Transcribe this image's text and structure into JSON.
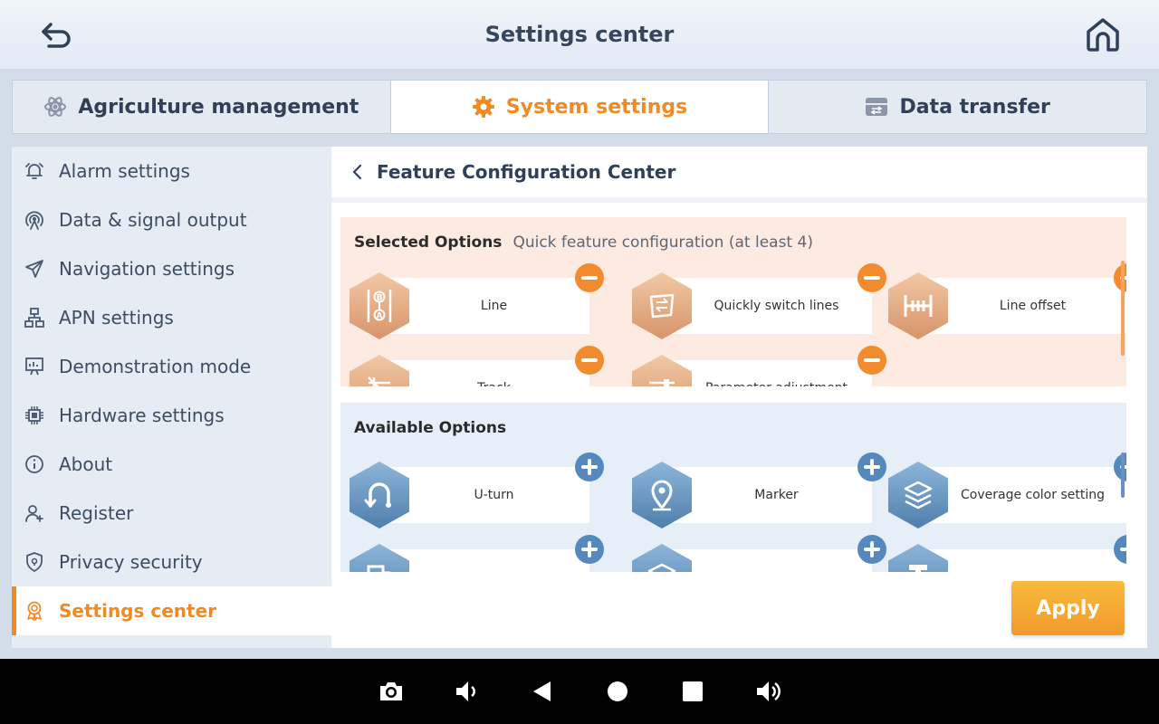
{
  "header": {
    "title": "Settings center"
  },
  "tabs": [
    {
      "label": "Agriculture management",
      "icon": "atom-icon"
    },
    {
      "label": "System settings",
      "icon": "gear-icon",
      "active": true
    },
    {
      "label": "Data transfer",
      "icon": "database-icon"
    }
  ],
  "sidebar": {
    "items": [
      {
        "label": "Alarm settings",
        "icon": "bell-icon"
      },
      {
        "label": "Data & signal output",
        "icon": "signal-icon"
      },
      {
        "label": "Navigation settings",
        "icon": "send-icon"
      },
      {
        "label": "APN settings",
        "icon": "network-icon"
      },
      {
        "label": "Demonstration mode",
        "icon": "presentation-icon"
      },
      {
        "label": "Hardware settings",
        "icon": "chip-icon"
      },
      {
        "label": "About",
        "icon": "info-icon"
      },
      {
        "label": "Register",
        "icon": "user-add-icon"
      },
      {
        "label": "Privacy security",
        "icon": "shield-icon"
      },
      {
        "label": "Settings center",
        "icon": "award-icon",
        "active": true
      }
    ]
  },
  "content": {
    "title": "Feature Configuration Center",
    "selected": {
      "heading": "Selected Options",
      "subheading": "Quick feature configuration (at least 4)",
      "items": [
        {
          "label": "Line",
          "icon": "ab-line-icon"
        },
        {
          "label": "Quickly switch lines",
          "icon": "switch-lines-icon"
        },
        {
          "label": "Line offset",
          "icon": "line-offset-icon"
        },
        {
          "label": "Track",
          "icon": "track-icon"
        },
        {
          "label": "Parameter adjustment",
          "icon": "parameter-icon"
        }
      ]
    },
    "available": {
      "heading": "Available Options",
      "items": [
        {
          "label": "U-turn",
          "icon": "u-turn-icon"
        },
        {
          "label": "Marker",
          "icon": "marker-icon"
        },
        {
          "label": "Coverage color setting",
          "icon": "layers-icon"
        },
        {
          "label": "",
          "icon": "implement-icon"
        },
        {
          "label": "",
          "icon": "layers-icon"
        },
        {
          "label": "",
          "icon": "tool-icon"
        }
      ]
    },
    "apply_label": "Apply"
  },
  "colors": {
    "accent": "#f08a22",
    "remove": "#f28a2e",
    "add": "#5588bc",
    "text": "#2f4058"
  },
  "navbar": [
    "camera-icon",
    "volume-down-icon",
    "back-triangle-icon",
    "home-circle-icon",
    "recent-square-icon",
    "volume-up-icon"
  ]
}
